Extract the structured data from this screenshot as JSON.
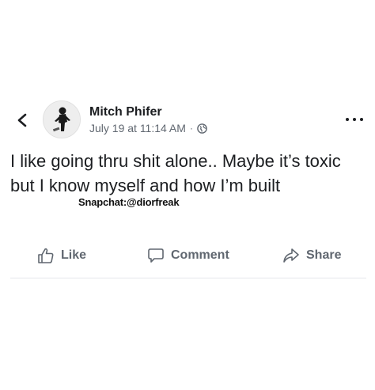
{
  "post": {
    "author_name": "Mitch Phifer",
    "date": "July 19 at 11:14 AM",
    "separator": "·",
    "privacy_icon": "globe-icon",
    "text": "I like going thru shit alone.. Maybe it’s toxic but I know myself and how I’m built",
    "watermark": "Snapchat:@diorfreak"
  },
  "header": {
    "back_icon": "chevron-left-icon",
    "more_icon": "more-horizontal-icon"
  },
  "actions": {
    "like_label": "Like",
    "comment_label": "Comment",
    "share_label": "Share"
  },
  "colors": {
    "text_primary": "#1c1e21",
    "text_secondary": "#606770",
    "divider": "#e4e6eb",
    "background": "#ffffff"
  }
}
